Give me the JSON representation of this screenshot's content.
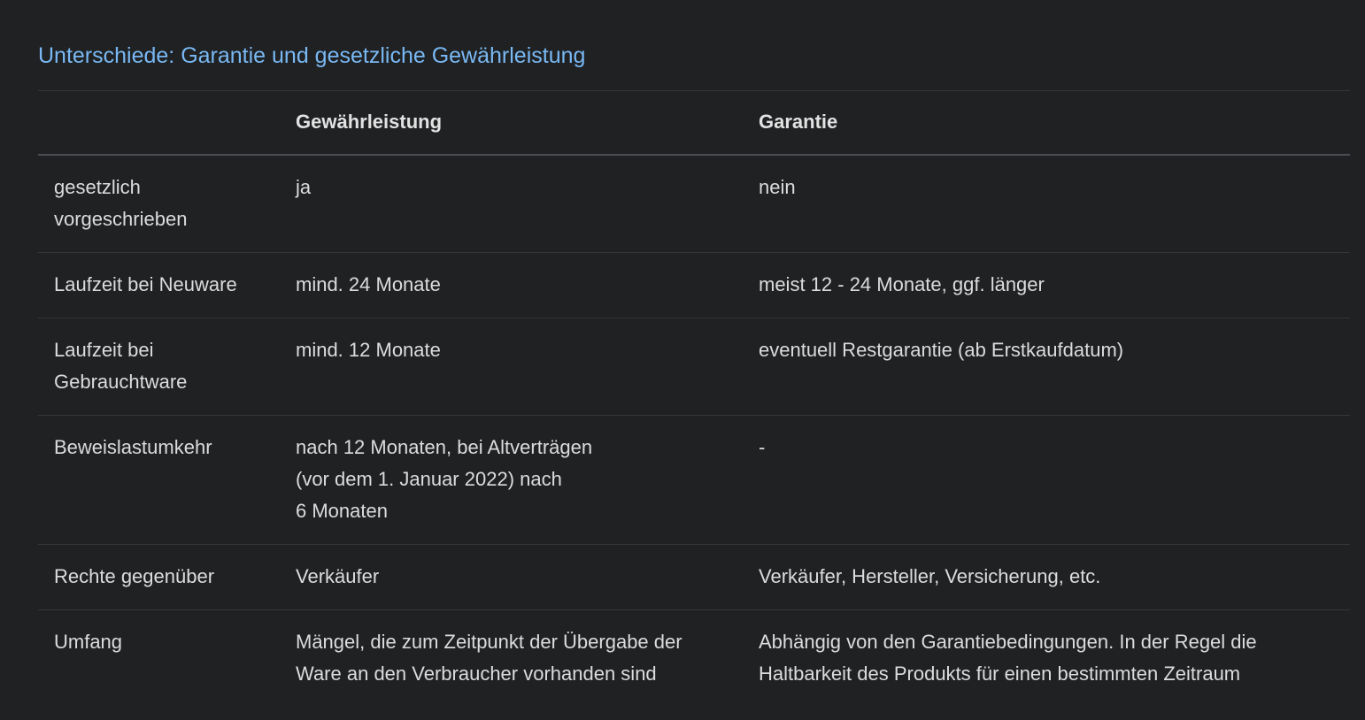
{
  "section": {
    "title": "Unterschiede: Garantie und gesetzliche Gewährleistung"
  },
  "table": {
    "headers": [
      "",
      "Gewährleistung",
      "Garantie"
    ],
    "rows": [
      {
        "label_lines": [
          "gesetzlich",
          "vorgeschrieben"
        ],
        "gewaehrleistung_lines": [
          "ja"
        ],
        "garantie_lines": [
          "nein"
        ]
      },
      {
        "label_lines": [
          "Laufzeit bei Neuware"
        ],
        "gewaehrleistung_lines": [
          "mind. 24 Monate"
        ],
        "garantie_lines": [
          "meist 12 - 24 Monate, ggf. länger"
        ]
      },
      {
        "label_lines": [
          "Laufzeit bei",
          "Gebrauchtware"
        ],
        "gewaehrleistung_lines": [
          "mind. 12 Monate"
        ],
        "garantie_lines": [
          "eventuell Restgarantie (ab Erstkaufdatum)"
        ]
      },
      {
        "label_lines": [
          "Beweislastumkehr"
        ],
        "gewaehrleistung_lines": [
          "nach 12 Monaten, bei Altverträgen",
          "(vor dem 1. Januar 2022) nach",
          "6 Monaten"
        ],
        "garantie_lines": [
          "-"
        ]
      },
      {
        "label_lines": [
          "Rechte gegenüber"
        ],
        "gewaehrleistung_lines": [
          "Verkäufer"
        ],
        "garantie_lines": [
          "Verkäufer, Hersteller, Versicherung, etc."
        ]
      },
      {
        "label_lines": [
          "Umfang"
        ],
        "gewaehrleistung_lines": [
          "Mängel, die zum Zeitpunkt der Übergabe der",
          "Ware an den Verbraucher vorhanden sind"
        ],
        "garantie_lines": [
          "Abhängig von den Garantiebedingungen. In der Regel die",
          "Haltbarkeit des Produkts für einen bestimmten Zeitraum"
        ]
      }
    ]
  }
}
